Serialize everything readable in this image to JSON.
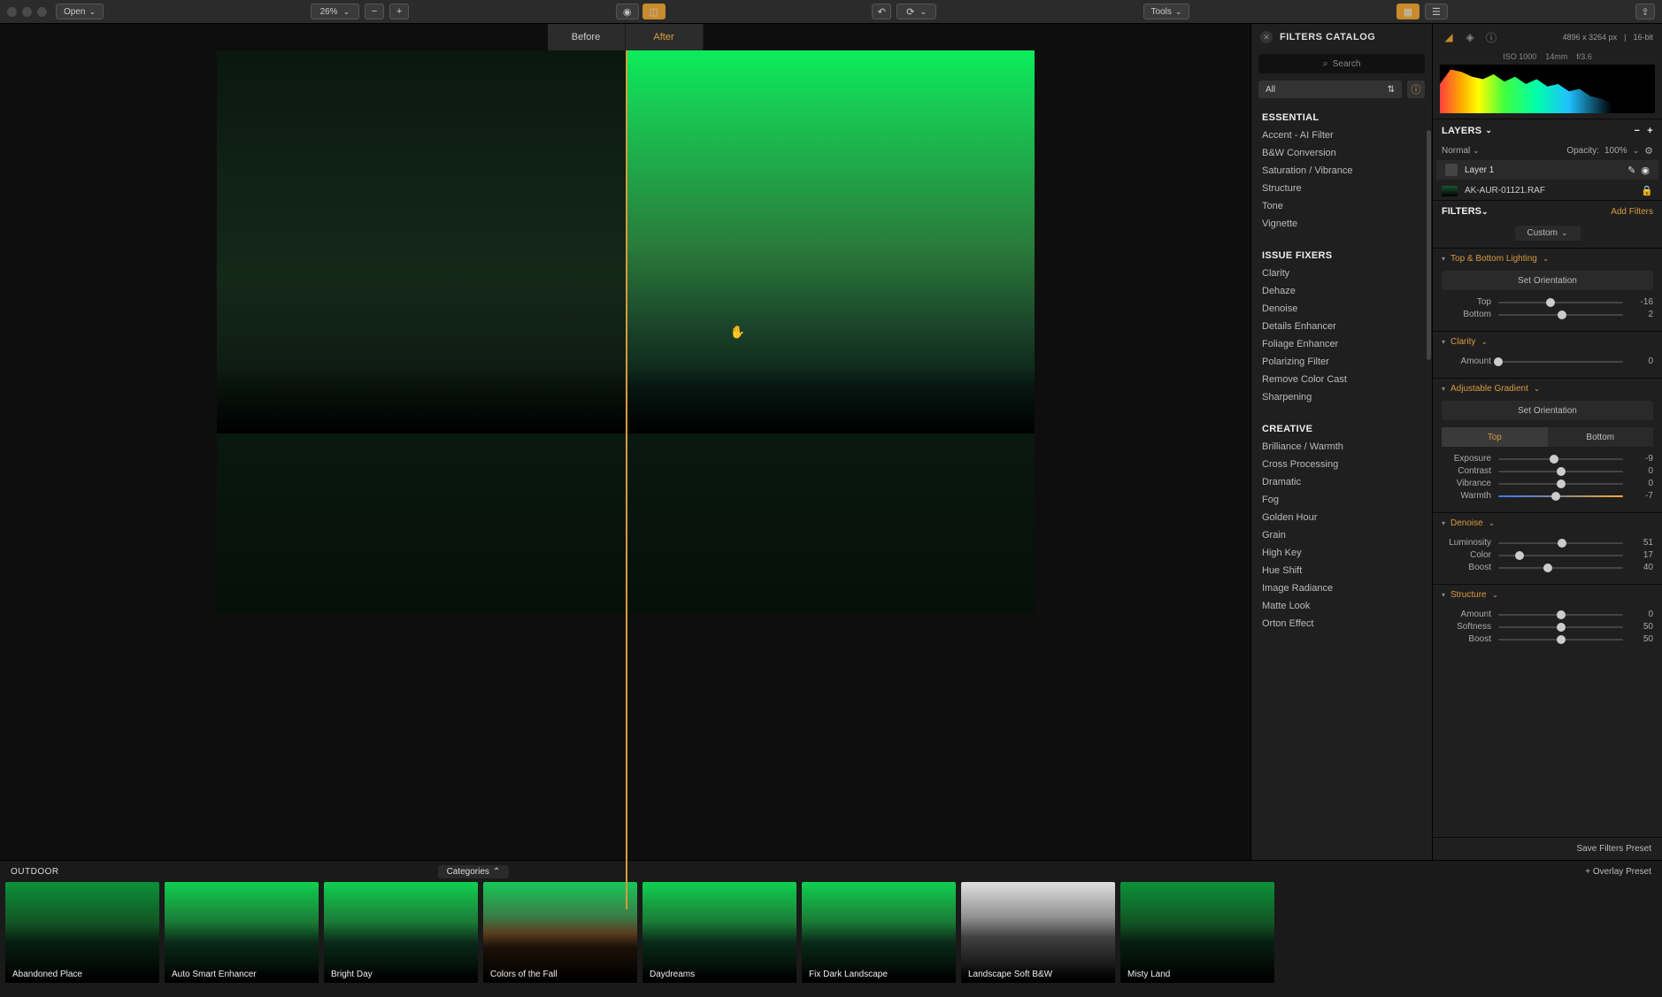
{
  "toolbar": {
    "open": "Open",
    "zoom": "26%",
    "tools": "Tools"
  },
  "compare": {
    "before": "Before",
    "after": "After"
  },
  "catalog": {
    "title": "FILTERS CATALOG",
    "search": "Search",
    "select": "All",
    "sections": {
      "essential": {
        "title": "ESSENTIAL",
        "items": [
          "Accent - AI Filter",
          "B&W Conversion",
          "Saturation / Vibrance",
          "Structure",
          "Tone",
          "Vignette"
        ]
      },
      "issue": {
        "title": "ISSUE FIXERS",
        "items": [
          "Clarity",
          "Dehaze",
          "Denoise",
          "Details Enhancer",
          "Foliage Enhancer",
          "Polarizing Filter",
          "Remove Color Cast",
          "Sharpening"
        ]
      },
      "creative": {
        "title": "CREATIVE",
        "items": [
          "Brilliance / Warmth",
          "Cross Processing",
          "Dramatic",
          "Fog",
          "Golden Hour",
          "Grain",
          "High Key",
          "Hue Shift",
          "Image Radiance",
          "Matte Look",
          "Orton Effect"
        ]
      }
    }
  },
  "info": {
    "dims": "4896 x 3264 px",
    "depth": "16-bit",
    "iso": "ISO 1000",
    "focal": "14mm",
    "aperture": "f/3.6"
  },
  "layers": {
    "title": "LAYERS",
    "blend": "Normal",
    "opacity_label": "Opacity:",
    "opacity_value": "100%",
    "layer1": "Layer 1",
    "base": "AK-AUR-01121.RAF"
  },
  "filters_panel": {
    "title": "FILTERS",
    "add": "Add Filters",
    "preset": "Custom"
  },
  "filter_blocks": {
    "tb": {
      "title": "Top & Bottom Lighting",
      "orient": "Set Orientation",
      "top_label": "Top",
      "top_val": "-16",
      "bottom_label": "Bottom",
      "bottom_val": "2"
    },
    "clarity": {
      "title": "Clarity",
      "amount_label": "Amount",
      "amount_val": "0"
    },
    "grad": {
      "title": "Adjustable Gradient",
      "orient": "Set Orientation",
      "top_tab": "Top",
      "bottom_tab": "Bottom",
      "exposure_label": "Exposure",
      "exposure_val": "-9",
      "contrast_label": "Contrast",
      "contrast_val": "0",
      "vibrance_label": "Vibrance",
      "vibrance_val": "0",
      "warmth_label": "Warmth",
      "warmth_val": "-7"
    },
    "denoise": {
      "title": "Denoise",
      "lum_label": "Luminosity",
      "lum_val": "51",
      "color_label": "Color",
      "color_val": "17",
      "boost_label": "Boost",
      "boost_val": "40"
    },
    "structure": {
      "title": "Structure",
      "amount_label": "Amount",
      "amount_val": "0",
      "softness_label": "Softness",
      "softness_val": "50",
      "boost_label": "Boost",
      "boost_val": "50"
    }
  },
  "save_preset": "Save Filters Preset",
  "presets": {
    "category": "OUTDOOR",
    "categories_btn": "Categories",
    "overlay": "+ Overlay Preset",
    "items": [
      "Abandoned Place",
      "Auto Smart Enhancer",
      "Bright Day",
      "Colors of the Fall",
      "Daydreams",
      "Fix Dark Landscape",
      "Landscape Soft B&W",
      "Misty Land"
    ]
  }
}
